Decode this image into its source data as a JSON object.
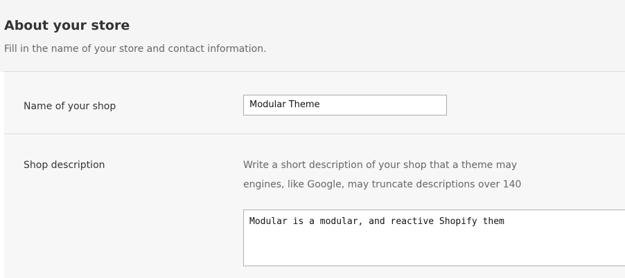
{
  "section": {
    "title": "About your store",
    "subtitle": "Fill in the name of your store and contact information."
  },
  "fields": {
    "shop_name": {
      "label": "Name of your shop",
      "value": "Modular Theme"
    },
    "shop_description": {
      "label": "Shop description",
      "help_line_1": "Write a short description of your shop that a theme may",
      "help_line_2": "engines, like Google, may truncate descriptions over 140",
      "value": "Modular is a modular, and reactive Shopify them"
    }
  }
}
